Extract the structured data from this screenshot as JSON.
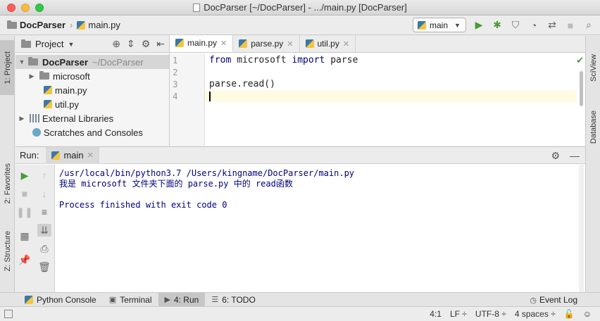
{
  "window": {
    "title": "DocParser [~/DocParser] - .../main.py [DocParser]"
  },
  "navbar": {
    "project_crumb": "DocParser",
    "file_crumb": "main.py",
    "run_config": "main"
  },
  "left_strip": {
    "project_tab": "1: Project",
    "favorites_tab": "2: Favorites",
    "structure_tab": "Z: Structure"
  },
  "right_strip": {
    "sciview_tab": "SciView",
    "database_tab": "Database"
  },
  "project_panel": {
    "header": "Project",
    "tree": {
      "root_name": "DocParser",
      "root_path": "~/DocParser",
      "folder": "microsoft",
      "file1": "main.py",
      "file2": "util.py",
      "external": "External Libraries",
      "scratches": "Scratches and Consoles"
    }
  },
  "editor": {
    "tabs": [
      "main.py",
      "parse.py",
      "util.py"
    ],
    "line_numbers": [
      "1",
      "2",
      "3",
      "4"
    ],
    "code": {
      "line1_kw1": "from",
      "line1_mod": " microsoft ",
      "line1_kw2": "import",
      "line1_rest": " parse",
      "line2": "",
      "line3": "parse.read()",
      "line4": ""
    }
  },
  "run_panel": {
    "label": "Run:",
    "tab": "main",
    "output": [
      "/usr/local/bin/python3.7 /Users/kingname/DocParser/main.py",
      "我是 microsoft 文件夹下面的 parse.py 中的 read函数",
      "",
      "Process finished with exit code 0"
    ]
  },
  "bottom_tools": {
    "python_console": "Python Console",
    "terminal": "Terminal",
    "run": "4: Run",
    "todo": "6: TODO",
    "event_log": "Event Log"
  },
  "status_bar": {
    "position": "4:1",
    "line_sep": "LF ÷",
    "encoding": "UTF-8 ÷",
    "indent": "4 spaces ÷"
  },
  "colors": {
    "keyword": "#000080",
    "run_green": "#4a9a3a",
    "current_line": "#fffbe3"
  }
}
